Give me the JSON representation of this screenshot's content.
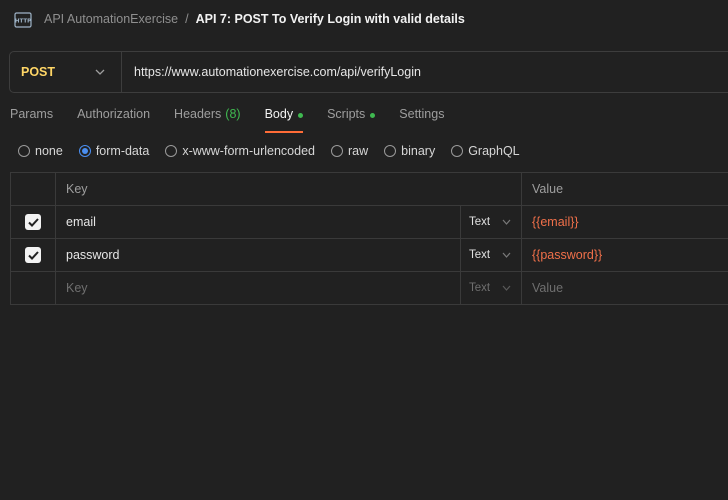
{
  "header": {
    "icon": "http-icon",
    "collection": "API AutomationExercise",
    "separator": "/",
    "request_name": "API 7: POST To Verify Login with valid details"
  },
  "urlbar": {
    "method": "POST",
    "url": "https://www.automationexercise.com/api/verifyLogin"
  },
  "tabs": {
    "params": "Params",
    "authorization": "Authorization",
    "headers": "Headers",
    "headers_count": "(8)",
    "body": "Body",
    "scripts": "Scripts",
    "settings": "Settings",
    "active": "Body"
  },
  "body_types": {
    "none": "none",
    "form_data": "form-data",
    "urlencoded": "x-www-form-urlencoded",
    "raw": "raw",
    "binary": "binary",
    "graphql": "GraphQL",
    "selected": "form-data"
  },
  "table": {
    "col_key": "Key",
    "col_value": "Value",
    "rows": [
      {
        "checked": true,
        "key": "email",
        "type": "Text",
        "value": "{{email}}"
      },
      {
        "checked": true,
        "key": "password",
        "type": "Text",
        "value": "{{password}}"
      }
    ],
    "new_row": {
      "key_placeholder": "Key",
      "type": "Text",
      "value_placeholder": "Value"
    }
  },
  "colors": {
    "background": "#212121",
    "method_post": "#ffd666",
    "accent_orange": "#ff6c37",
    "variable": "#f0704a",
    "green_indicator": "#3fb950",
    "radio_selected": "#4a8ef0"
  }
}
